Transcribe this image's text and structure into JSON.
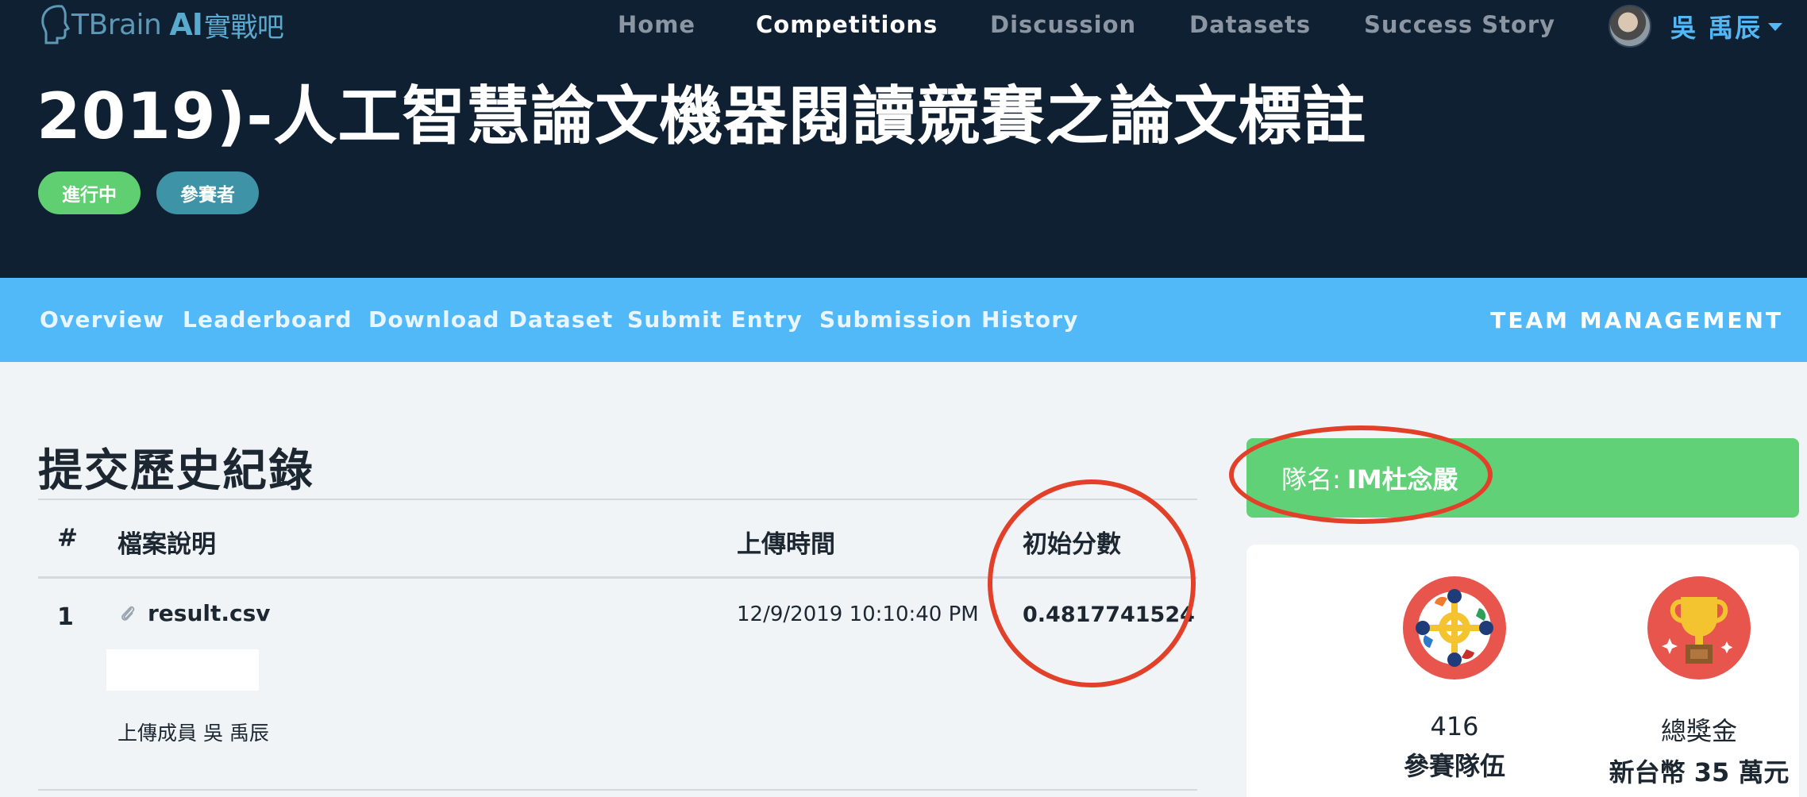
{
  "brand": {
    "name": "TBrain",
    "ai": "AI",
    "cn": "實戰吧"
  },
  "topnav": {
    "items": [
      "Home",
      "Competitions",
      "Discussion",
      "Datasets",
      "Success Story"
    ],
    "active": "Competitions"
  },
  "user": {
    "name": "吳 禹辰"
  },
  "competition": {
    "title": "2019)-人工智慧論文機器閱讀競賽之論文標註",
    "badges": [
      "進行中",
      "參賽者"
    ]
  },
  "subnav": {
    "items": [
      "Overview",
      "Leaderboard",
      "Download Dataset",
      "Submit Entry",
      "Submission History"
    ],
    "team_management": "TEAM MANAGEMENT"
  },
  "history": {
    "title": "提交歷史紀錄",
    "columns": [
      "#",
      "檔案說明",
      "上傳時間",
      "初始分數"
    ],
    "rows": [
      {
        "num": "1",
        "file": "result.csv",
        "time": "12/9/2019 10:10:40 PM",
        "score": "0.4817741524",
        "uploader": "上傳成員 吳 禹辰"
      }
    ]
  },
  "team": {
    "label": "隊名:",
    "name": "IM杜念嚴"
  },
  "stats": [
    {
      "value": "416",
      "label": "參賽隊伍",
      "icon": "teams-icon"
    },
    {
      "value": "總獎金",
      "label": "新台幣 35 萬元",
      "icon": "trophy-icon"
    }
  ],
  "colors": {
    "header_bg": "#0f2032",
    "subnav_bg": "#52b9f9",
    "badge_green": "#5fcf72",
    "badge_teal": "#3e93a7",
    "team_banner": "#61d178",
    "annotation": "#e3402a",
    "stat_icon_bg": "#e8554d"
  }
}
